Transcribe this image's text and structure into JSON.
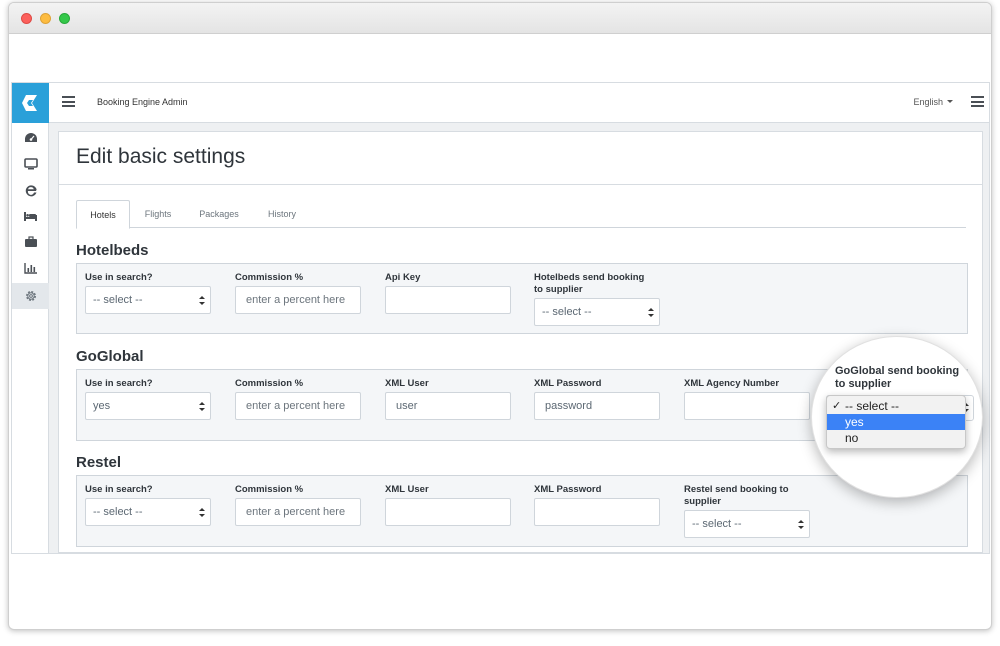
{
  "header": {
    "app_title": "Booking Engine Admin",
    "language": "English"
  },
  "sidebar": {
    "items": [
      {
        "icon": "dashboard-icon"
      },
      {
        "icon": "monitor-icon"
      },
      {
        "icon": "browser-icon"
      },
      {
        "icon": "bed-icon"
      },
      {
        "icon": "briefcase-icon"
      },
      {
        "icon": "bar-chart-icon"
      },
      {
        "icon": "gear-icon",
        "active": true
      }
    ]
  },
  "page": {
    "title": "Edit basic settings",
    "tabs": [
      {
        "label": "Hotels",
        "active": true
      },
      {
        "label": "Flights"
      },
      {
        "label": "Packages"
      },
      {
        "label": "History"
      }
    ]
  },
  "sections": {
    "hotelbeds": {
      "title": "Hotelbeds",
      "use_in_search_label": "Use in search?",
      "use_in_search_value": "-- select --",
      "commission_label": "Commission %",
      "commission_placeholder": "enter a percent here",
      "api_key_label": "Api Key",
      "api_key_value": "",
      "send_booking_label_1": "Hotelbeds send booking",
      "send_booking_label_2": "to supplier",
      "send_booking_value": "-- select --"
    },
    "goglobal": {
      "title": "GoGlobal",
      "use_in_search_label": "Use in search?",
      "use_in_search_value": "yes",
      "commission_label": "Commission %",
      "commission_placeholder": "enter a percent here",
      "xml_user_label": "XML User",
      "xml_user_value": "user",
      "xml_password_label": "XML Password",
      "xml_password_value": "password",
      "xml_agency_label": "XML Agency Number",
      "xml_agency_value": "",
      "send_booking_label_1": "GoGlobal send booking",
      "send_booking_label_2": "to supplier",
      "send_booking_options": [
        "-- select --",
        "yes",
        "no"
      ],
      "send_booking_selected": "-- select --",
      "send_booking_highlighted": "yes",
      "check_mark": "✓"
    },
    "restel": {
      "title": "Restel",
      "use_in_search_label": "Use in search?",
      "use_in_search_value": "-- select --",
      "commission_label": "Commission %",
      "commission_placeholder": "enter a percent here",
      "xml_user_label": "XML User",
      "xml_user_value": "",
      "xml_password_label": "XML Password",
      "xml_password_value": "",
      "send_booking_label_1": "Restel send booking to",
      "send_booking_label_2": "supplier",
      "send_booking_value": "-- select --"
    }
  },
  "colors": {
    "brand": "#2aa0d9",
    "highlight": "#3b82f6"
  }
}
